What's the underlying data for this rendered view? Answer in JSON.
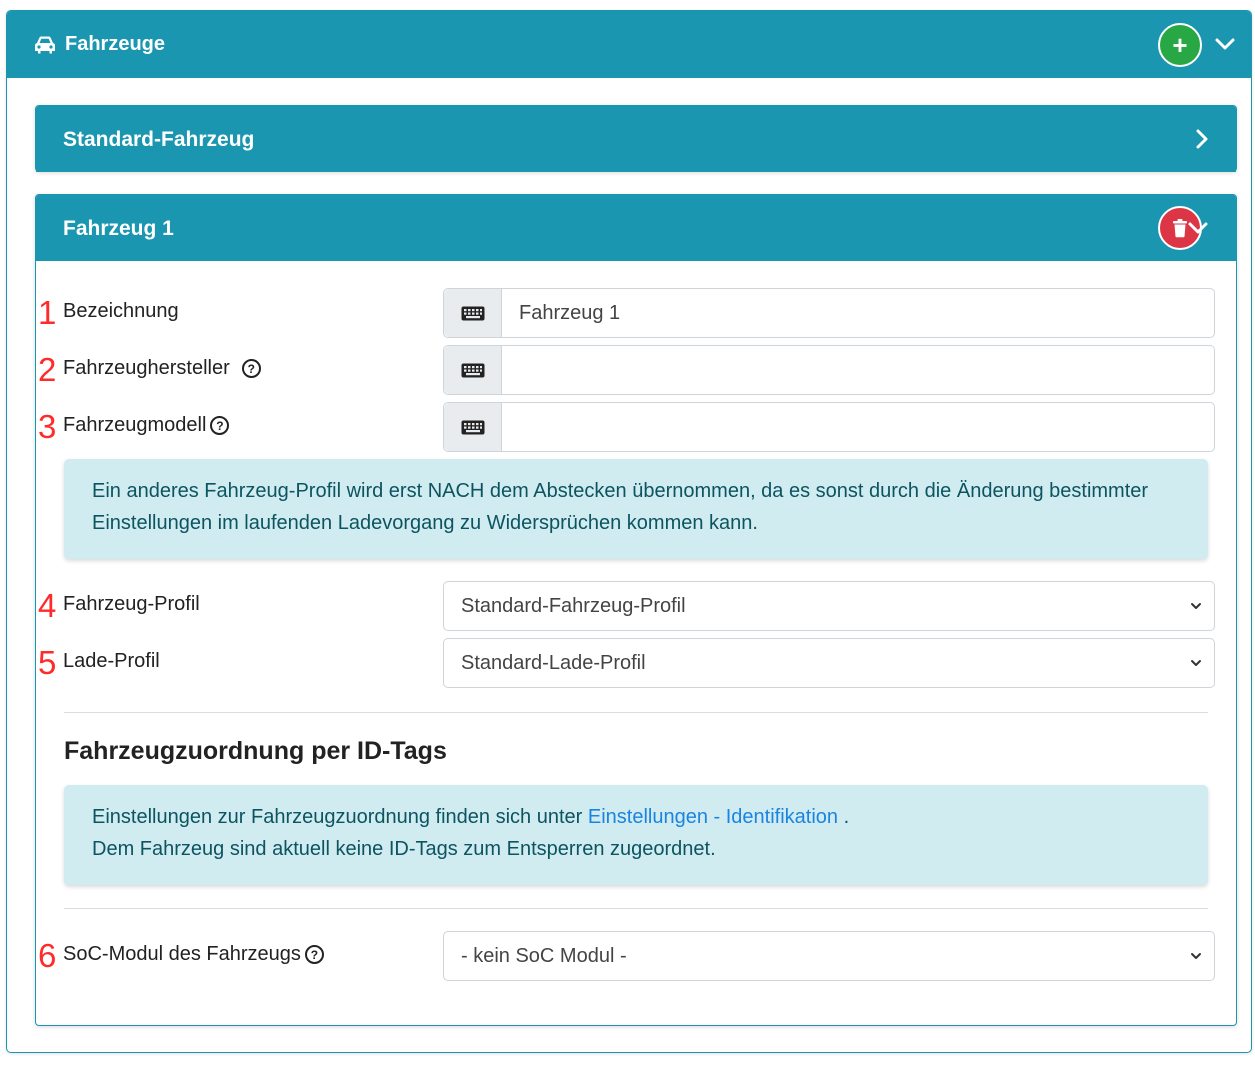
{
  "header": {
    "title": "Fahrzeuge"
  },
  "standard_card": {
    "title": "Standard-Fahrzeug"
  },
  "vehicle_card": {
    "title": "Fahrzeug 1",
    "fields": {
      "bezeichnung": {
        "number": "1",
        "label": "Bezeichnung",
        "value": "Fahrzeug 1"
      },
      "hersteller": {
        "number": "2",
        "label": "Fahrzeughersteller",
        "value": ""
      },
      "modell": {
        "number": "3",
        "label": "Fahrzeugmodell",
        "value": ""
      }
    },
    "info_profile": "Ein anderes Fahrzeug-Profil wird erst NACH dem Abstecken übernommen, da es sonst durch die Änderung bestimmter Einstellungen im laufenden Ladevorgang zu Widersprüchen kommen kann.",
    "selects": {
      "fahrzeug_profil": {
        "number": "4",
        "label": "Fahrzeug-Profil",
        "value": "Standard-Fahrzeug-Profil"
      },
      "lade_profil": {
        "number": "5",
        "label": "Lade-Profil",
        "value": "Standard-Lade-Profil"
      },
      "soc_modul": {
        "number": "6",
        "label": "SoC-Modul des Fahrzeugs",
        "value": "- kein SoC Modul -"
      }
    },
    "id_tags": {
      "heading": "Fahrzeugzuordnung per ID-Tags",
      "text_before": "Einstellungen zur Fahrzeugzuordnung finden sich unter ",
      "link": "Einstellungen - Identifikation",
      "text_after": " .",
      "line2": "Dem Fahrzeug sind aktuell keine ID-Tags zum Entsperren zugeordnet."
    }
  },
  "help_symbol": "?",
  "colors": {
    "header": "#1b96b0",
    "add": "#28a745",
    "delete": "#dc3545",
    "alert_bg": "#d1ecf1",
    "link": "#1a84e0",
    "annotation": "#ff2a2a"
  },
  "icons": [
    "car-icon",
    "plus-icon",
    "chevron-down-icon",
    "chevron-right-icon",
    "trash-icon",
    "keyboard-icon",
    "help-icon"
  ]
}
